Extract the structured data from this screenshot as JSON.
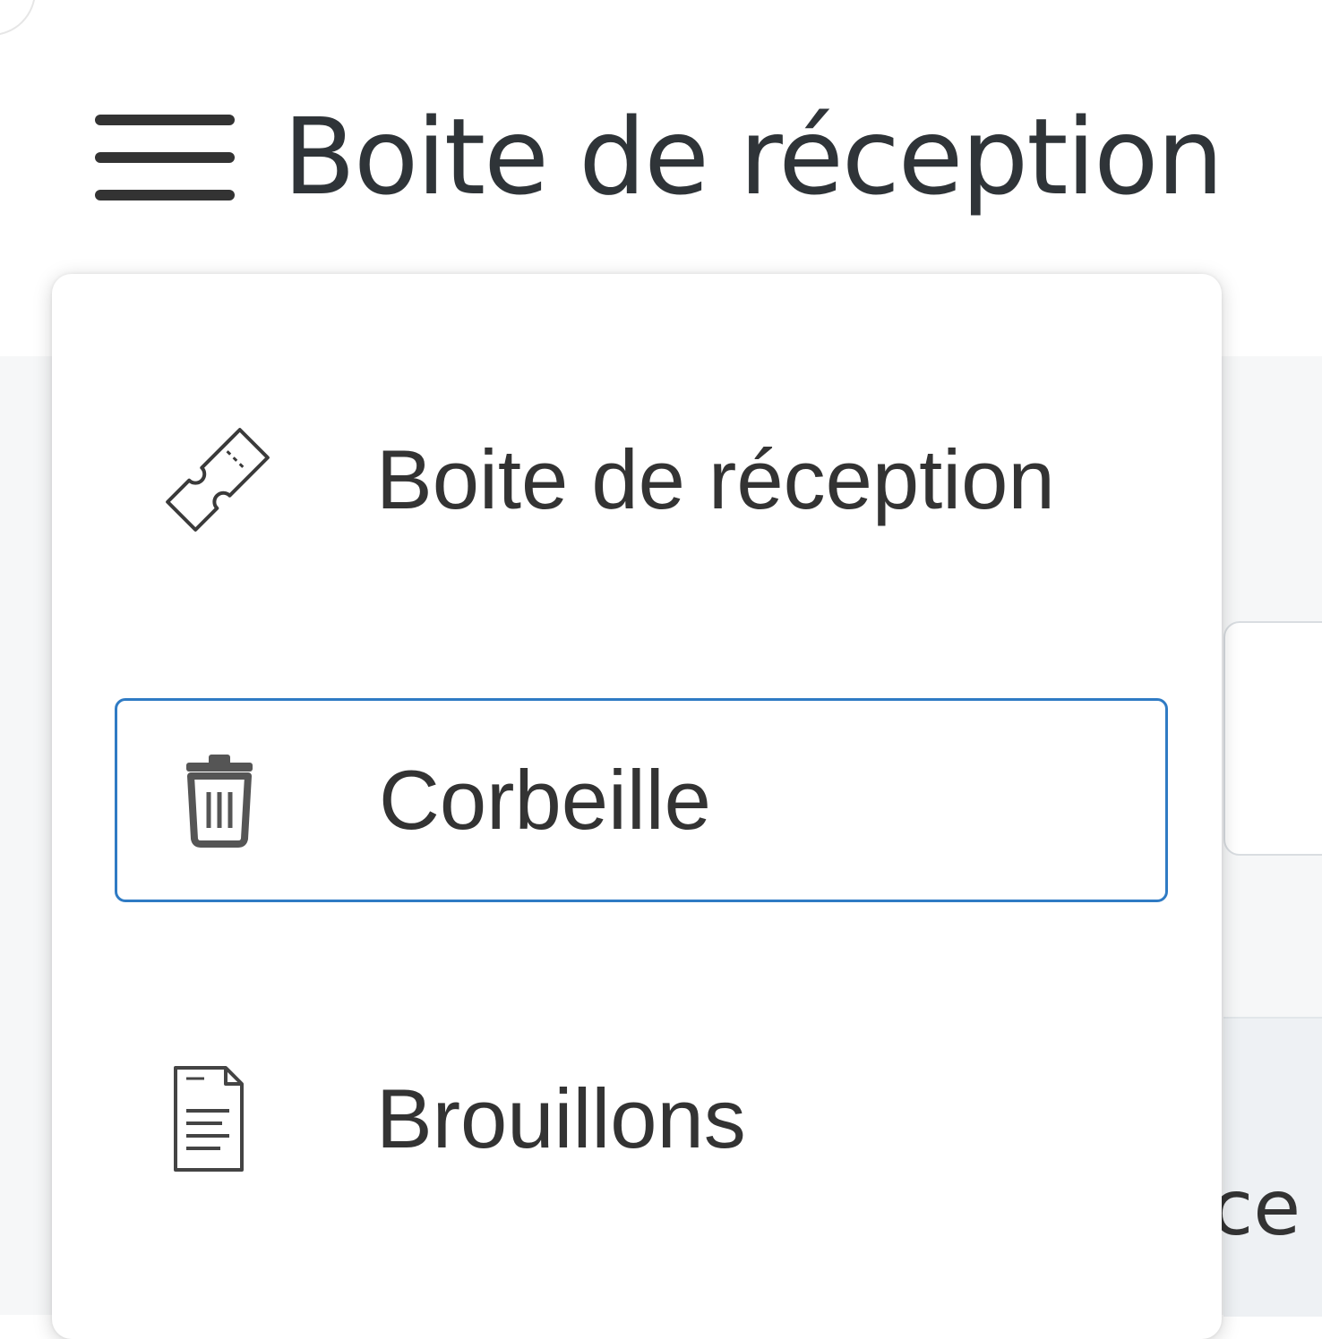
{
  "header": {
    "title": "Boite de réception",
    "menu_icon": "hamburger-menu-icon"
  },
  "menu": {
    "items": [
      {
        "label": "Boite de réception",
        "icon": "ticket-icon",
        "focused": false
      },
      {
        "label": "Corbeille",
        "icon": "trash-icon",
        "focused": true
      },
      {
        "label": "Brouillons",
        "icon": "document-icon",
        "focused": false
      }
    ]
  },
  "background": {
    "partial_text": "ce"
  },
  "colors": {
    "focus_border": "#2f7bc4",
    "text": "#333333"
  }
}
